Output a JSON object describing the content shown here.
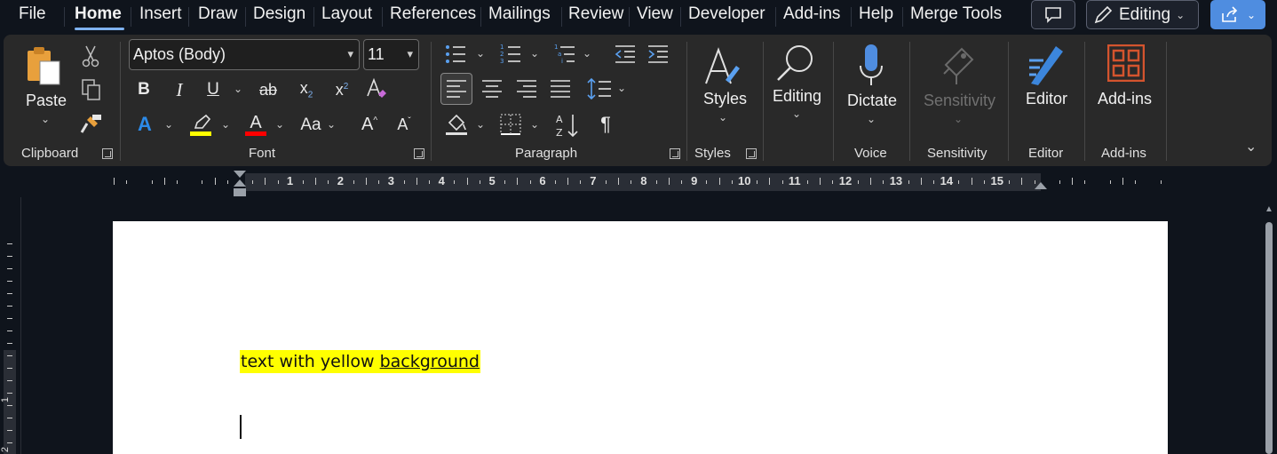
{
  "menu": {
    "items": [
      "File",
      "Home",
      "Insert",
      "Draw",
      "Design",
      "Layout",
      "References",
      "Mailings",
      "Review",
      "View",
      "Developer",
      "Add-ins",
      "Help",
      "Merge Tools"
    ],
    "active": "Home",
    "editing_label": "Editing"
  },
  "ribbon": {
    "clipboard": {
      "paste_label": "Paste",
      "group_label": "Clipboard"
    },
    "font": {
      "font_name": "Aptos (Body)",
      "font_size": "11",
      "group_label": "Font",
      "case_label": "Aa",
      "highlight_color": "#ffff00",
      "font_color": "#ff0000"
    },
    "paragraph": {
      "group_label": "Paragraph"
    },
    "styles": {
      "button_label": "Styles",
      "group_label": "Styles"
    },
    "editing": {
      "button_label": "Editing"
    },
    "voice": {
      "button_label": "Dictate",
      "group_label": "Voice"
    },
    "sensitivity": {
      "button_label": "Sensitivity",
      "group_label": "Sensitivity"
    },
    "editor": {
      "button_label": "Editor",
      "group_label": "Editor"
    },
    "addins": {
      "button_label": "Add-ins",
      "group_label": "Add-ins"
    }
  },
  "ruler": {
    "numbers": [
      "1",
      "2",
      "3",
      "4",
      "5",
      "6",
      "7",
      "8",
      "9",
      "10",
      "11",
      "12",
      "13",
      "14",
      "15"
    ],
    "vertical_numbers": [
      "1",
      "2"
    ]
  },
  "document": {
    "text_plain": "text with yellow ",
    "text_underlined": "background",
    "highlight": "#ffff00"
  },
  "colors": {
    "accent": "#4f8de0",
    "menu_underline": "#7fb2f0",
    "ribbon_bg": "#292929",
    "app_bg": "#0f141c"
  },
  "icons": [
    "speech-bubble-icon",
    "pencil-icon",
    "share-icon",
    "paste-icon",
    "scissors-icon",
    "copy-icon",
    "format-painter-icon",
    "bold-icon",
    "italic-icon",
    "underline-icon",
    "strikethrough-icon",
    "subscript-icon",
    "superscript-icon",
    "clear-formatting-icon",
    "text-effects-icon",
    "highlighter-icon",
    "font-color-icon",
    "grow-font-icon",
    "shrink-font-icon",
    "bullets-icon",
    "numbering-icon",
    "multilevel-list-icon",
    "decrease-indent-icon",
    "increase-indent-icon",
    "align-left-icon",
    "align-center-icon",
    "align-right-icon",
    "justify-icon",
    "line-spacing-icon",
    "shading-icon",
    "borders-icon",
    "sort-icon",
    "pilcrow-icon",
    "styles-icon",
    "find-icon",
    "microphone-icon",
    "sensitivity-icon",
    "editor-icon",
    "add-ins-icon"
  ]
}
